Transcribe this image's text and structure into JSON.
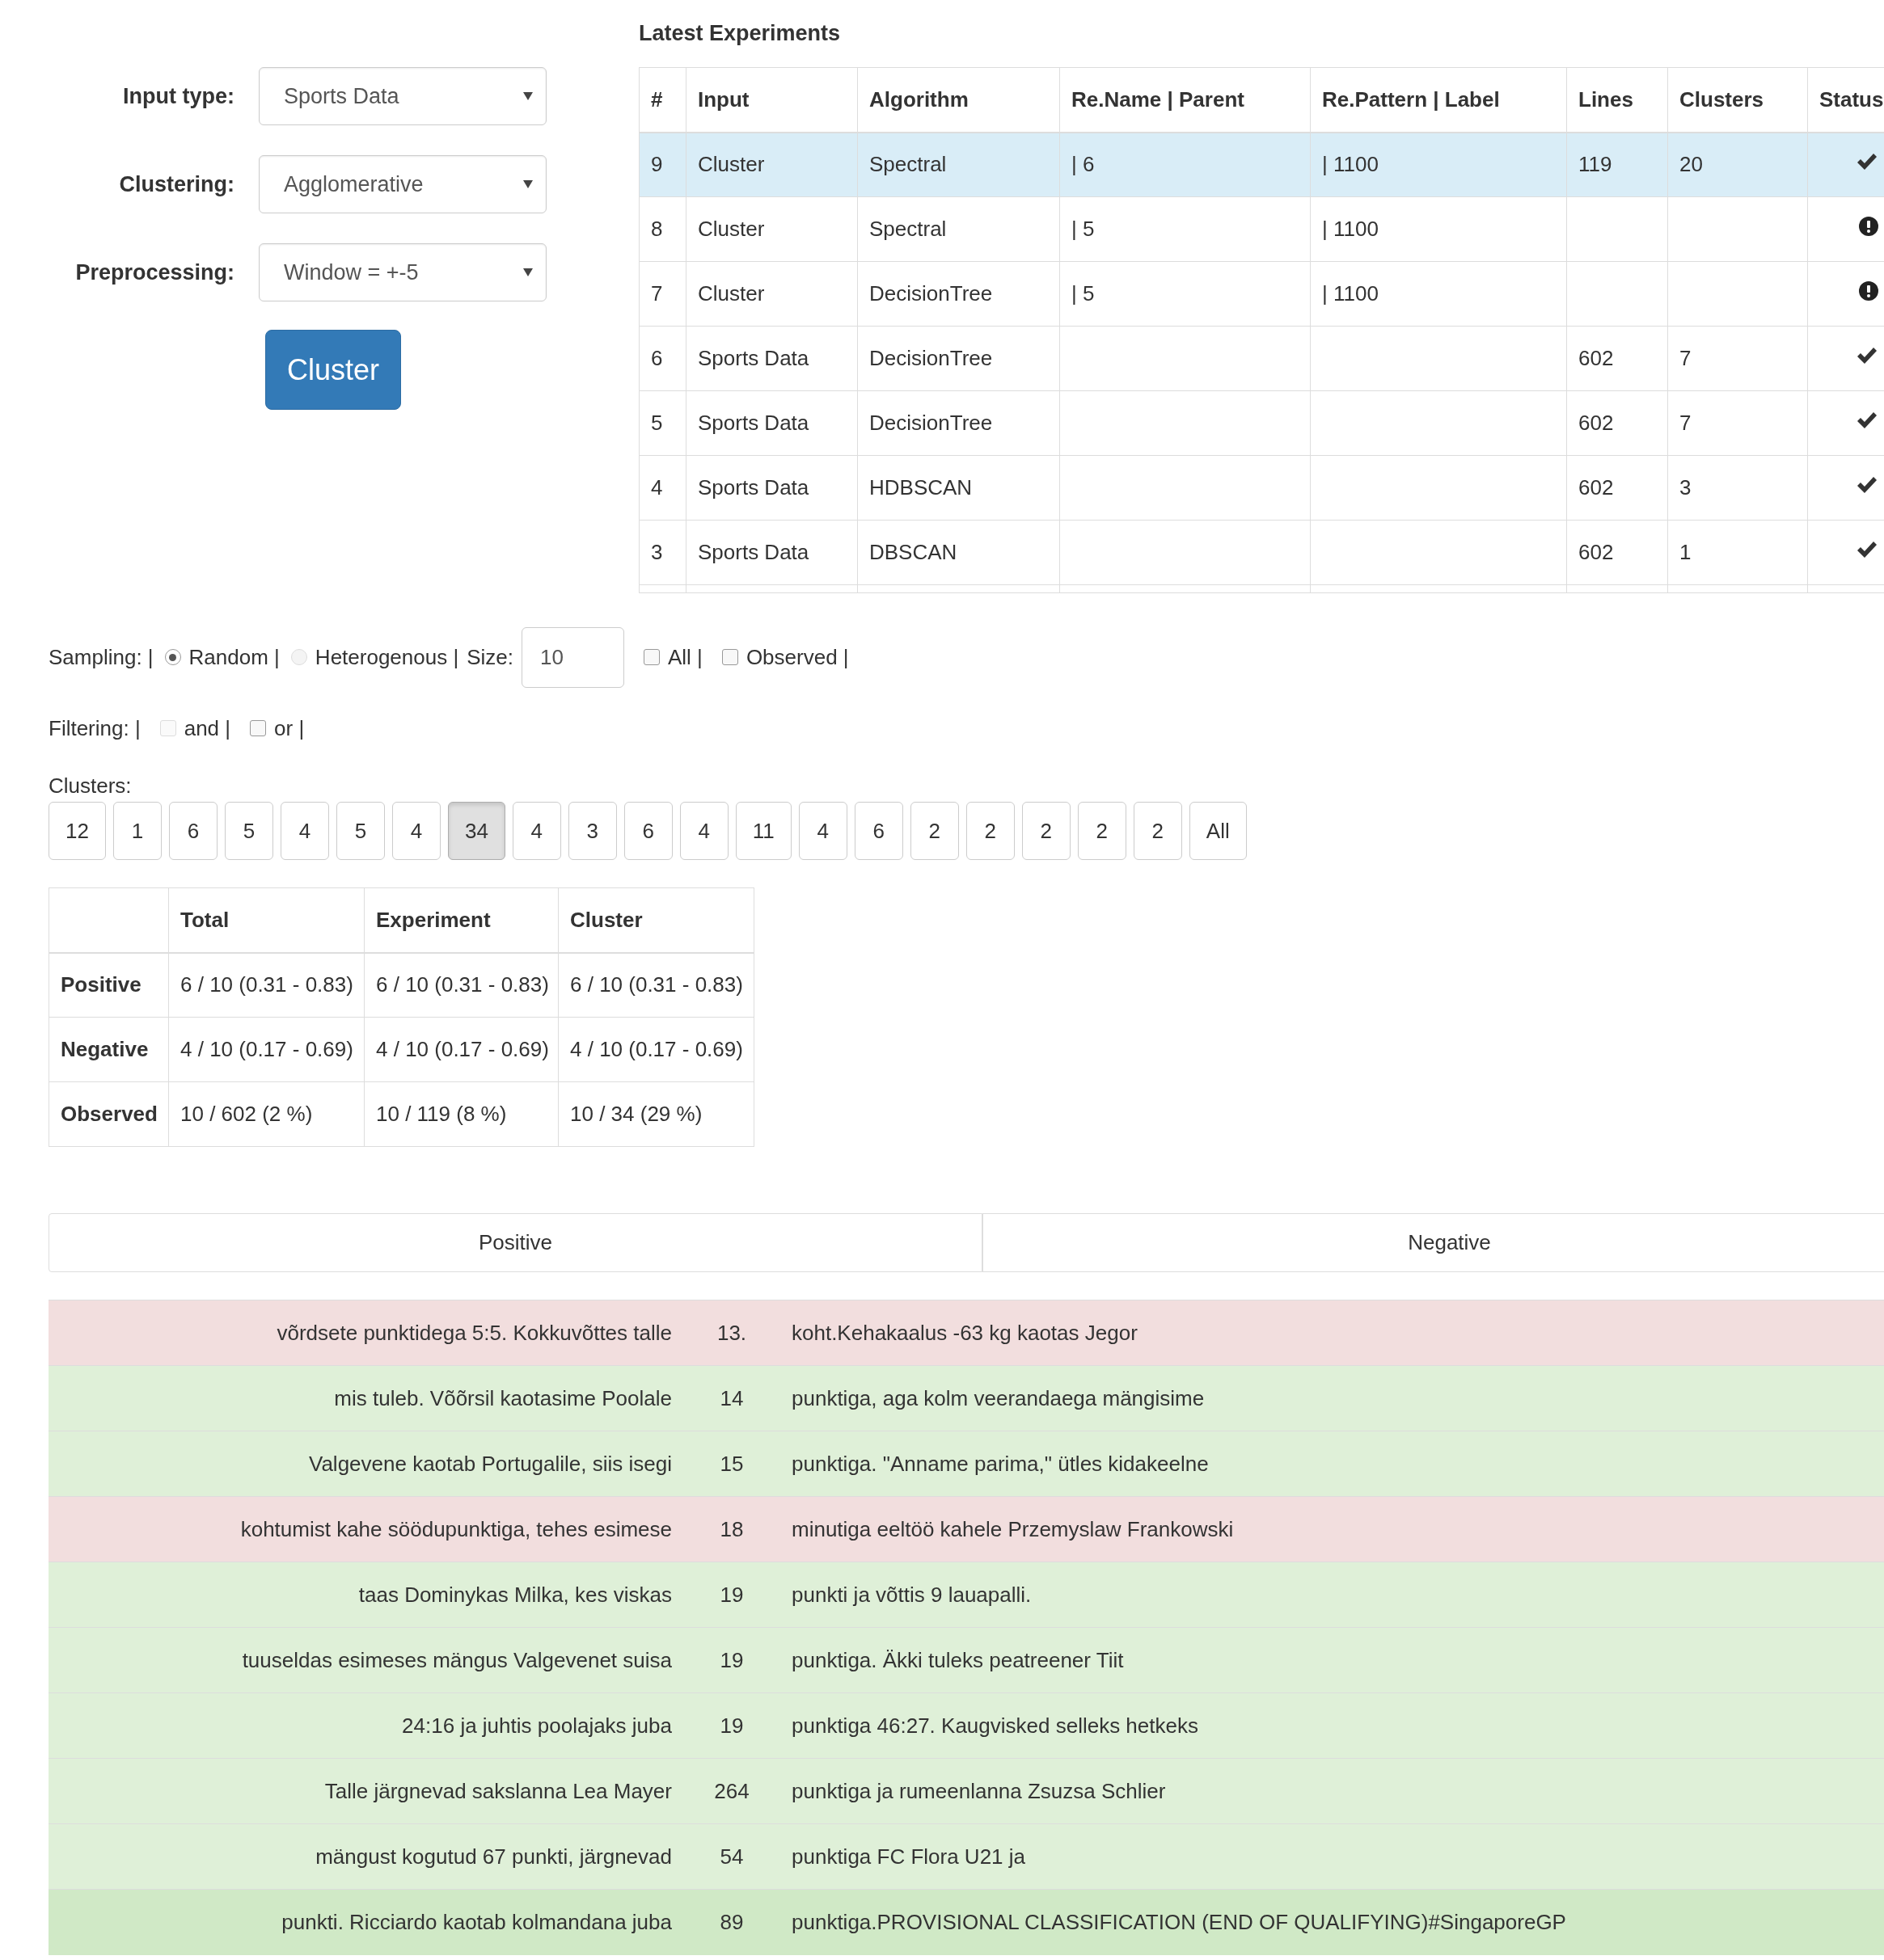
{
  "form": {
    "fields": [
      {
        "label": "Input type:",
        "value": "Sports Data"
      },
      {
        "label": "Clustering:",
        "value": "Agglomerative"
      },
      {
        "label": "Preprocessing:",
        "value": "Window = +-5"
      }
    ],
    "button": "Cluster"
  },
  "experiments": {
    "title": "Latest Experiments",
    "columns": [
      "#",
      "Input",
      "Algorithm",
      "Re.Name | Parent",
      "Re.Pattern | Label",
      "Lines",
      "Clusters",
      "Status"
    ],
    "rows": [
      {
        "cells": [
          "9",
          "Cluster",
          "Spectral",
          "| 6",
          "| 1100",
          "119",
          "20"
        ],
        "kind": "ok",
        "selected": true
      },
      {
        "cells": [
          "8",
          "Cluster",
          "Spectral",
          "| 5",
          "| 1100",
          "",
          ""
        ],
        "kind": "error",
        "selected": false
      },
      {
        "cells": [
          "7",
          "Cluster",
          "DecisionTree",
          "| 5",
          "| 1100",
          "",
          ""
        ],
        "kind": "error",
        "selected": false
      },
      {
        "cells": [
          "6",
          "Sports Data",
          "DecisionTree",
          "",
          "",
          "602",
          "7"
        ],
        "kind": "ok",
        "selected": false
      },
      {
        "cells": [
          "5",
          "Sports Data",
          "DecisionTree",
          "",
          "",
          "602",
          "7"
        ],
        "kind": "ok",
        "selected": false
      },
      {
        "cells": [
          "4",
          "Sports Data",
          "HDBSCAN",
          "",
          "",
          "602",
          "3"
        ],
        "kind": "ok",
        "selected": false
      },
      {
        "cells": [
          "3",
          "Sports Data",
          "DBSCAN",
          "",
          "",
          "602",
          "1"
        ],
        "kind": "ok",
        "selected": false
      }
    ]
  },
  "sampling": {
    "label": "Sampling: |",
    "options": [
      {
        "label": "Random |",
        "selected": true,
        "disabled": false
      },
      {
        "label": "Heterogenous |",
        "selected": false,
        "disabled": true
      }
    ],
    "size_label": "Size:",
    "size_value": "10",
    "checkboxes": [
      {
        "label": "All |",
        "checked": false
      },
      {
        "label": "Observed |",
        "checked": false
      }
    ]
  },
  "filtering": {
    "label": "Filtering: |",
    "checkboxes": [
      {
        "label": "and |",
        "checked": false,
        "disabled": true
      },
      {
        "label": "or |",
        "checked": false,
        "disabled": false
      }
    ]
  },
  "clusters": {
    "label": "Clusters:",
    "buttons": [
      {
        "label": "12",
        "selected": false
      },
      {
        "label": "1",
        "selected": false
      },
      {
        "label": "6",
        "selected": false
      },
      {
        "label": "5",
        "selected": false
      },
      {
        "label": "4",
        "selected": false
      },
      {
        "label": "5",
        "selected": false
      },
      {
        "label": "4",
        "selected": false
      },
      {
        "label": "34",
        "selected": true
      },
      {
        "label": "4",
        "selected": false
      },
      {
        "label": "3",
        "selected": false
      },
      {
        "label": "6",
        "selected": false
      },
      {
        "label": "4",
        "selected": false
      },
      {
        "label": "11",
        "selected": false
      },
      {
        "label": "4",
        "selected": false
      },
      {
        "label": "6",
        "selected": false
      },
      {
        "label": "2",
        "selected": false
      },
      {
        "label": "2",
        "selected": false
      },
      {
        "label": "2",
        "selected": false
      },
      {
        "label": "2",
        "selected": false
      },
      {
        "label": "2",
        "selected": false
      },
      {
        "label": "All",
        "selected": false
      }
    ]
  },
  "stats": {
    "columns": [
      "",
      "Total",
      "Experiment",
      "Cluster"
    ],
    "rows": [
      {
        "cells": [
          "Positive",
          "6 / 10 (0.31 - 0.83)",
          "6 / 10 (0.31 - 0.83)",
          "6 / 10 (0.31 - 0.83)"
        ]
      },
      {
        "cells": [
          "Negative",
          "4 / 10 (0.17 - 0.69)",
          "4 / 10 (0.17 - 0.69)",
          "4 / 10 (0.17 - 0.69)"
        ]
      },
      {
        "cells": [
          "Observed",
          "10 / 602 (2 %)",
          "10 / 119 (8 %)",
          "10 / 34 (29 %)"
        ]
      }
    ]
  },
  "label_tabs": [
    "Positive",
    "Negative"
  ],
  "lines": [
    {
      "left": "võrdsete punktidega 5:5. Kokkuvõttes talle",
      "match": "13.",
      "right": "koht.Kehakaalus -63 kg kaotas Jegor",
      "kind": "negative",
      "highlighted": false
    },
    {
      "left": "mis tuleb. Võõrsil kaotasime Poolale",
      "match": "14",
      "right": "punktiga, aga kolm veerandaega mängisime",
      "kind": "positive",
      "highlighted": false
    },
    {
      "left": "Valgevene kaotab Portugalile, siis isegi",
      "match": "15",
      "right": "punktiga. \"Anname parima,\" ütles kidakeelne",
      "kind": "positive",
      "highlighted": false
    },
    {
      "left": "kohtumist kahe söödupunktiga, tehes esimese",
      "match": "18",
      "right": "minutiga eeltöö kahele Przemyslaw Frankowski",
      "kind": "negative",
      "highlighted": false
    },
    {
      "left": "taas Dominykas Milka, kes viskas",
      "match": "19",
      "right": "punkti ja võttis 9 lauapalli.",
      "kind": "positive",
      "highlighted": false
    },
    {
      "left": "tuuseldas esimeses mängus Valgevenet suisa",
      "match": "19",
      "right": "punktiga. Äkki tuleks peatreener Tiit",
      "kind": "positive",
      "highlighted": false
    },
    {
      "left": "24:16 ja juhtis poolajaks juba",
      "match": "19",
      "right": "punktiga 46:27. Kaugvisked selleks hetkeks",
      "kind": "positive",
      "highlighted": false
    },
    {
      "left": "Talle järgnevad sakslanna Lea Mayer",
      "match": "264",
      "right": "punktiga ja rumeenlanna Zsuzsa Schlier",
      "kind": "positive",
      "highlighted": false
    },
    {
      "left": "mängust kogutud 67 punkti, järgnevad",
      "match": "54",
      "right": "punktiga FC Flora U21 ja",
      "kind": "positive",
      "highlighted": false
    },
    {
      "left": "punkti. Ricciardo kaotab kolmandana juba",
      "match": "89",
      "right": "punktiga.PROVISIONAL CLASSIFICATION (END OF QUALIFYING)#SingaporeGP",
      "kind": "positive",
      "highlighted": true
    }
  ]
}
